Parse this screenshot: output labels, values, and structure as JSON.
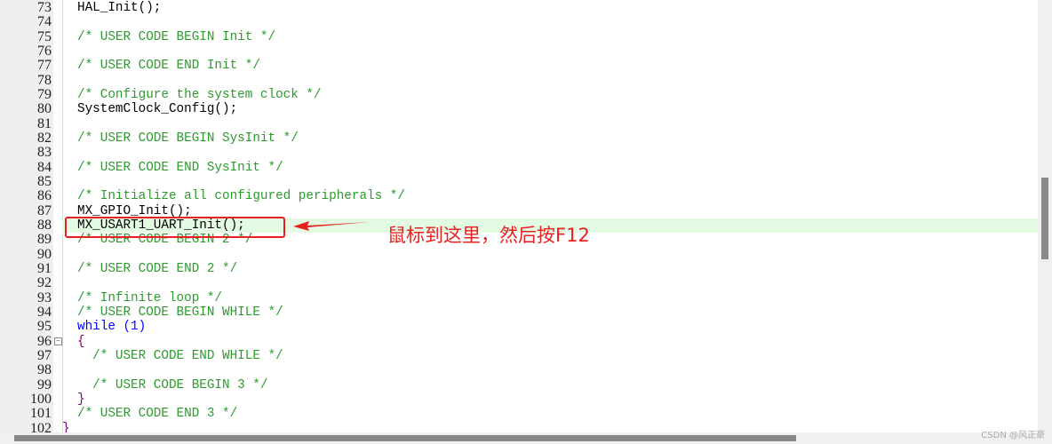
{
  "lines": [
    {
      "n": "73",
      "t": "HAL_Init();",
      "c": "code"
    },
    {
      "n": "74",
      "t": "",
      "c": "code"
    },
    {
      "n": "75",
      "t": "/* USER CODE BEGIN Init */",
      "c": "cm"
    },
    {
      "n": "76",
      "t": "",
      "c": "code"
    },
    {
      "n": "77",
      "t": "/* USER CODE END Init */",
      "c": "cm"
    },
    {
      "n": "78",
      "t": "",
      "c": "code"
    },
    {
      "n": "79",
      "t": "/* Configure the system clock */",
      "c": "cm"
    },
    {
      "n": "80",
      "t": "SystemClock_Config();",
      "c": "code"
    },
    {
      "n": "81",
      "t": "",
      "c": "code"
    },
    {
      "n": "82",
      "t": "/* USER CODE BEGIN SysInit */",
      "c": "cm"
    },
    {
      "n": "83",
      "t": "",
      "c": "code"
    },
    {
      "n": "84",
      "t": "/* USER CODE END SysInit */",
      "c": "cm"
    },
    {
      "n": "85",
      "t": "",
      "c": "code"
    },
    {
      "n": "86",
      "t": "/* Initialize all configured peripherals */",
      "c": "cm"
    },
    {
      "n": "87",
      "t": "MX_GPIO_Init();",
      "c": "code"
    },
    {
      "n": "88",
      "t": "MX_USART1_UART_Init();",
      "c": "code",
      "highlight": true
    },
    {
      "n": "89",
      "t": "/* USER CODE BEGIN 2 */",
      "c": "cm"
    },
    {
      "n": "90",
      "t": "",
      "c": "code"
    },
    {
      "n": "91",
      "t": "/* USER CODE END 2 */",
      "c": "cm"
    },
    {
      "n": "92",
      "t": "",
      "c": "code"
    },
    {
      "n": "93",
      "t": "/* Infinite loop */",
      "c": "cm"
    },
    {
      "n": "94",
      "t": "/* USER CODE BEGIN WHILE */",
      "c": "cm"
    },
    {
      "n": "95",
      "t": "while (1)",
      "c": "kw"
    },
    {
      "n": "96",
      "t": "{",
      "c": "br"
    },
    {
      "n": "97",
      "t": "  /* USER CODE END WHILE */",
      "c": "cm"
    },
    {
      "n": "98",
      "t": "",
      "c": "code"
    },
    {
      "n": "99",
      "t": "  /* USER CODE BEGIN 3 */",
      "c": "cm"
    },
    {
      "n": "100",
      "t": "}",
      "c": "br"
    },
    {
      "n": "101",
      "t": "/* USER CODE END 3 */",
      "c": "cm"
    },
    {
      "n": "102",
      "t": "}",
      "c": "br",
      "outer": true
    }
  ],
  "annotation": "鼠标到这里，然后按F12",
  "watermark": "CSDN @风正豪",
  "colors": {
    "annotation": "#e82020",
    "comment": "#2e9a2e",
    "keyword": "#0000ff",
    "highlight": "#e3fbe3"
  }
}
